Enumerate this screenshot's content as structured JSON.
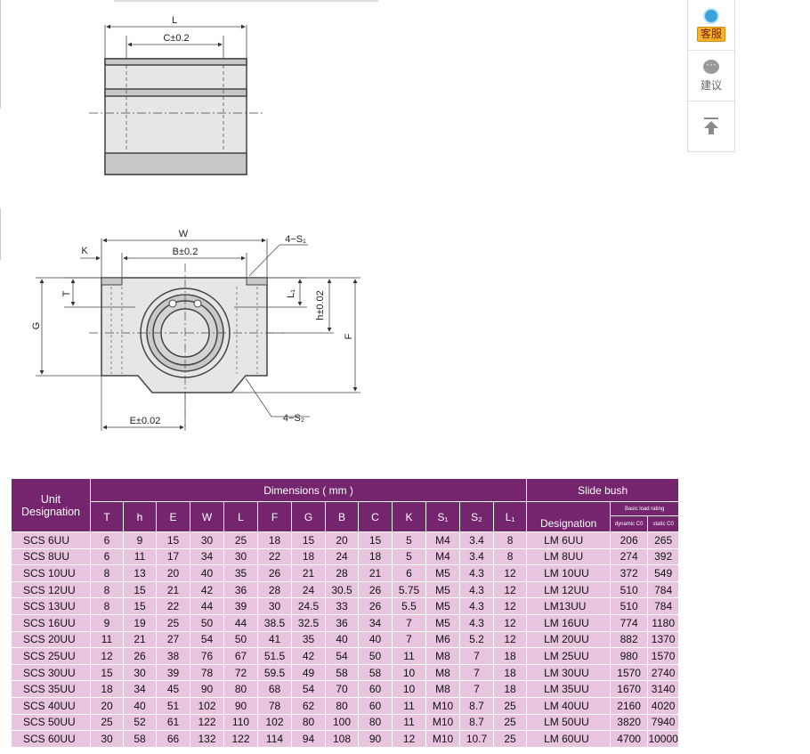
{
  "drawing": {
    "top_view": {
      "L": "L",
      "C": "C±0.2"
    },
    "front_view": {
      "W": "W",
      "B": "B±0.2",
      "K": "K",
      "S1": "4−S₁",
      "S2": "4−S₂",
      "T": "T",
      "G": "G",
      "L1": "L₁",
      "h": "h±0.02",
      "F": "F",
      "E": "E±0.02"
    }
  },
  "side_widget": {
    "service_label": "客服",
    "suggestion_label": "建议"
  },
  "table": {
    "header": {
      "unit_designation": "Unit\nDesignation",
      "dimensions": "Dimensions ( mm )",
      "slide_bush": "Slide bush",
      "designation": "Designation",
      "basic_load_rating": "Basic load rating",
      "dynamic": "dynamic C0",
      "static": "static C0",
      "columns": [
        "T",
        "h",
        "E",
        "W",
        "L",
        "F",
        "G",
        "B",
        "C",
        "K",
        "S₁",
        "S₂",
        "L₁"
      ]
    },
    "rows": [
      [
        "SCS 6UU",
        "6",
        "9",
        "15",
        "30",
        "25",
        "18",
        "15",
        "20",
        "15",
        "5",
        "M4",
        "3.4",
        "8",
        "LM 6UU",
        "206",
        "265"
      ],
      [
        "SCS 8UU",
        "6",
        "11",
        "17",
        "34",
        "30",
        "22",
        "18",
        "24",
        "18",
        "5",
        "M4",
        "3.4",
        "8",
        "LM 8UU",
        "274",
        "392"
      ],
      [
        "SCS 10UU",
        "8",
        "13",
        "20",
        "40",
        "35",
        "26",
        "21",
        "28",
        "21",
        "6",
        "M5",
        "4.3",
        "12",
        "LM 10UU",
        "372",
        "549"
      ],
      [
        "SCS 12UU",
        "8",
        "15",
        "21",
        "42",
        "36",
        "28",
        "24",
        "30.5",
        "26",
        "5.75",
        "M5",
        "4.3",
        "12",
        "LM 12UU",
        "510",
        "784"
      ],
      [
        "SCS 13UU",
        "8",
        "15",
        "22",
        "44",
        "39",
        "30",
        "24.5",
        "33",
        "26",
        "5.5",
        "M5",
        "4.3",
        "12",
        "LM13UU",
        "510",
        "784"
      ],
      [
        "SCS 16UU",
        "9",
        "19",
        "25",
        "50",
        "44",
        "38.5",
        "32.5",
        "36",
        "34",
        "7",
        "M5",
        "4.3",
        "12",
        "LM 16UU",
        "774",
        "1180"
      ],
      [
        "SCS 20UU",
        "11",
        "21",
        "27",
        "54",
        "50",
        "41",
        "35",
        "40",
        "40",
        "7",
        "M6",
        "5.2",
        "12",
        "LM 20UU",
        "882",
        "1370"
      ],
      [
        "SCS 25UU",
        "12",
        "26",
        "38",
        "76",
        "67",
        "51.5",
        "42",
        "54",
        "50",
        "11",
        "M8",
        "7",
        "18",
        "LM 25UU",
        "980",
        "1570"
      ],
      [
        "SCS 30UU",
        "15",
        "30",
        "39",
        "78",
        "72",
        "59.5",
        "49",
        "58",
        "58",
        "10",
        "M8",
        "7",
        "18",
        "LM 30UU",
        "1570",
        "2740"
      ],
      [
        "SCS 35UU",
        "18",
        "34",
        "45",
        "90",
        "80",
        "68",
        "54",
        "70",
        "60",
        "10",
        "M8",
        "7",
        "18",
        "LM 35UU",
        "1670",
        "3140"
      ],
      [
        "SCS 40UU",
        "20",
        "40",
        "51",
        "102",
        "90",
        "78",
        "62",
        "80",
        "60",
        "11",
        "M10",
        "8.7",
        "25",
        "LM 40UU",
        "2160",
        "4020"
      ],
      [
        "SCS 50UU",
        "25",
        "52",
        "61",
        "122",
        "110",
        "102",
        "80",
        "100",
        "80",
        "11",
        "M10",
        "8.7",
        "25",
        "LM 50UU",
        "3820",
        "7940"
      ],
      [
        "SCS 60UU",
        "30",
        "58",
        "66",
        "132",
        "122",
        "114",
        "94",
        "108",
        "90",
        "12",
        "M10",
        "10.7",
        "25",
        "LM 60UU",
        "4700",
        "10000"
      ]
    ]
  },
  "colors": {
    "header_bg": "#74256e",
    "row_bg": "#e9c4df"
  }
}
